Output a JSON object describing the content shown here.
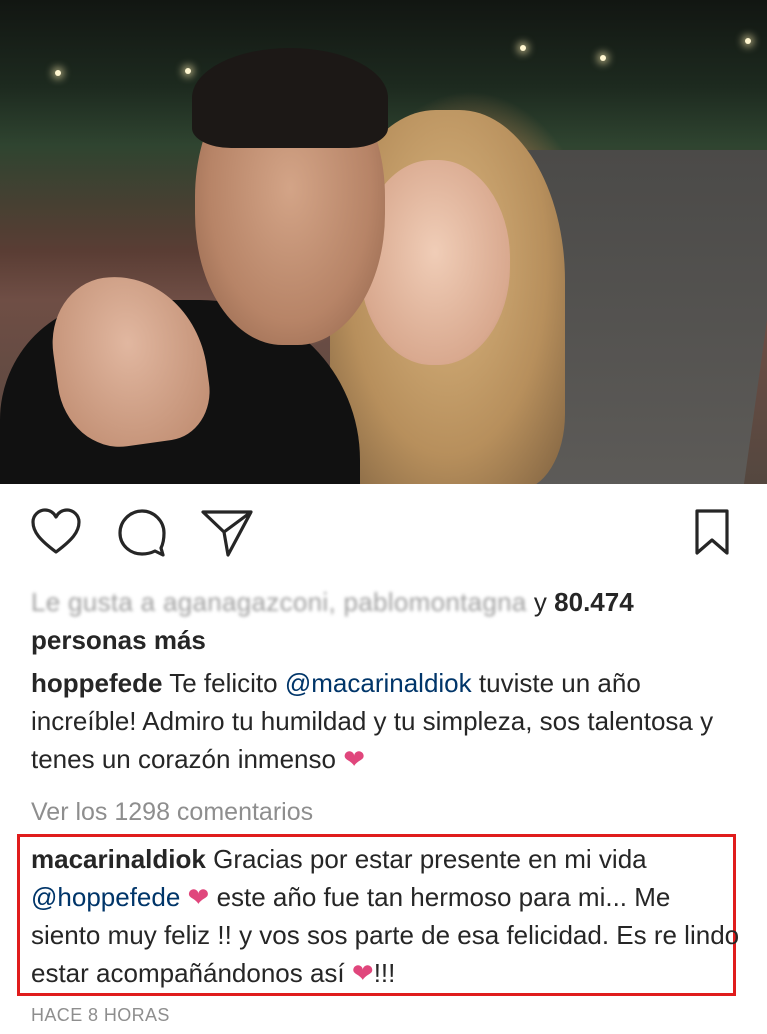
{
  "post": {
    "liked_by": {
      "blurred_names": "Le gusta a aganagazconi, pablomontagna",
      "conjunction": "y",
      "count": "80.474",
      "suffix": "personas más"
    },
    "caption": {
      "username": "hoppefede",
      "text_1": "Te felicito",
      "mention": "@macarinaldiok",
      "text_2": "tuviste un año increíble! Admiro tu humildad y tu simpleza, sos talentosa y tenes un corazón inmenso"
    },
    "view_comments": "Ver los 1298 comentarios",
    "reply": {
      "username": "macarinaldiok",
      "text_1": "Gracias por estar presente en mi vida",
      "mention": "@hoppefede",
      "text_2": "este año fue tan hermoso para mi... Me siento muy feliz !! y vos sos parte de esa felicidad. Es re lindo estar acompañándonos así",
      "exclamation": "!!!"
    },
    "timestamp": "HACE 8 HORAS"
  },
  "icons": [
    "heart-icon",
    "comment-icon",
    "share-icon",
    "bookmark-icon"
  ],
  "colors": {
    "text": "#262626",
    "mention": "#003569",
    "muted": "#8e8e8e",
    "heart_emoji": "#e0467c",
    "highlight_border": "#e01c1c"
  }
}
